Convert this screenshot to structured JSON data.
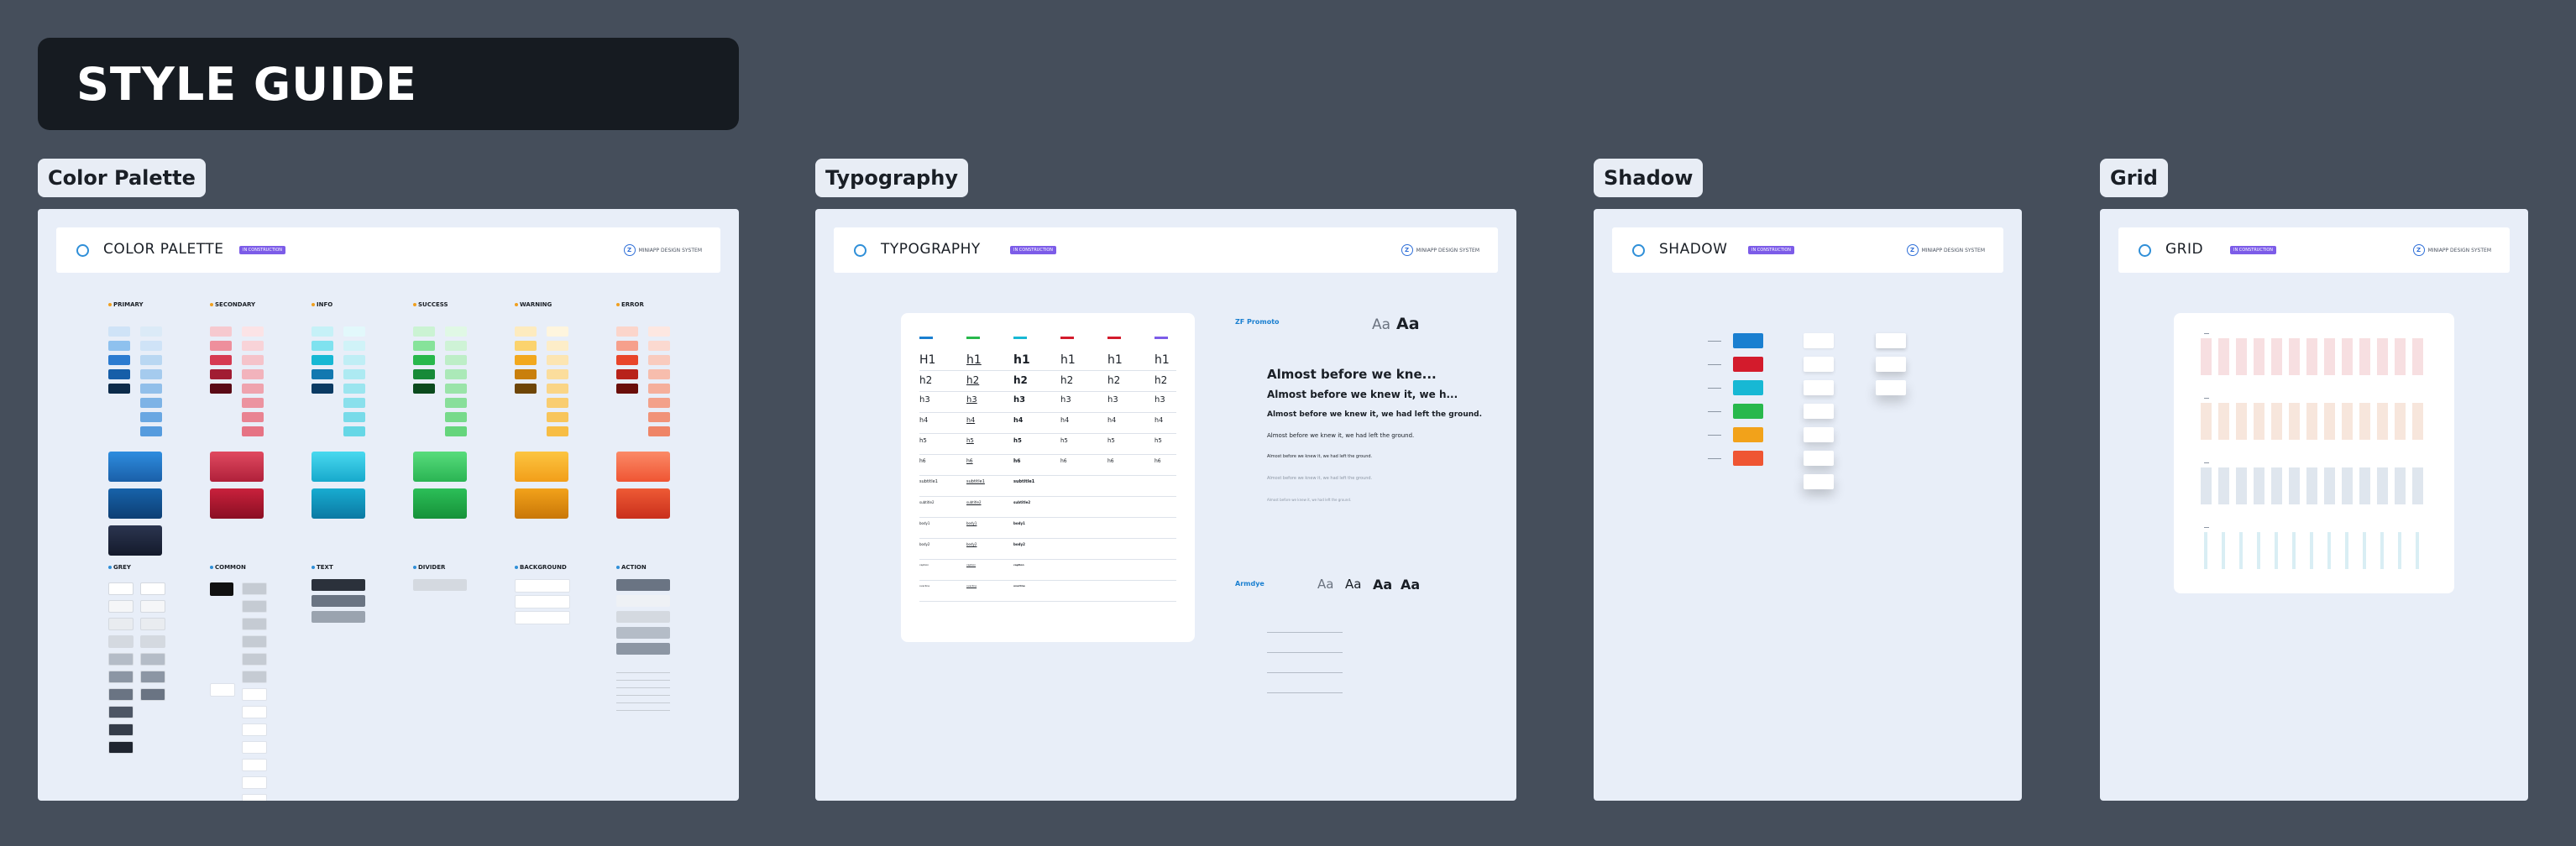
{
  "title": "STYLE GUIDE",
  "frames": {
    "color": {
      "label": "Color Palette",
      "title": "COLOR PALETTE",
      "badge": "IN CONSTRUCTION",
      "logo_text": "MINIAPP DESIGN SYSTEM"
    },
    "typography": {
      "label": "Typography",
      "title": "TYPOGRAPHY",
      "badge": "IN CONSTRUCTION",
      "logo_text": "MINIAPP DESIGN SYSTEM"
    },
    "shadow": {
      "label": "Shadow",
      "title": "SHADOW",
      "badge": "IN CONSTRUCTION",
      "logo_text": "MINIAPP DESIGN SYSTEM"
    },
    "grid": {
      "label": "Grid",
      "title": "GRID",
      "badge": "IN CONSTRUCTION",
      "logo_text": "MINIAPP DESIGN SYSTEM"
    }
  },
  "palette": {
    "groups": [
      {
        "name": "PRIMARY",
        "colors": [
          "#cfe3f7",
          "#8ec1ee",
          "#2b7bd0",
          "#165ea8",
          "#0b2a4a"
        ],
        "light": [
          "#dbeaf7",
          "#cfe3f7",
          "#b9d7f2",
          "#a5cbee",
          "#91bfea",
          "#7db3e6",
          "#69a7e2",
          "#559bde"
        ]
      },
      {
        "name": "SECONDARY",
        "colors": [
          "#f6c9cf",
          "#ee8f9c",
          "#d63a52",
          "#a11c33",
          "#5a0a16"
        ],
        "light": [
          "#fbe3e6",
          "#f8d3d8",
          "#f5c3ca",
          "#f2b3bc",
          "#efa3ae",
          "#ec93a0",
          "#e98392",
          "#e67384"
        ]
      },
      {
        "name": "INFO",
        "colors": [
          "#c6f1f7",
          "#7fe2ef",
          "#17b8d4",
          "#1278b0",
          "#0a3a63"
        ],
        "light": [
          "#e2f8fb",
          "#d0f3f8",
          "#bfeef5",
          "#adeaf2",
          "#9be5ef",
          "#8ae0ec",
          "#78dbe9",
          "#66d7e6"
        ]
      },
      {
        "name": "SUCCESS",
        "colors": [
          "#cbf3d3",
          "#86e39a",
          "#28b84c",
          "#178a38",
          "#0a4a1d"
        ],
        "light": [
          "#e0f8e5",
          "#cef3d6",
          "#bdeec7",
          "#abe9b8",
          "#9ae4a9",
          "#88df9a",
          "#77da8b",
          "#65d57c"
        ]
      },
      {
        "name": "WARNING",
        "colors": [
          "#fdebbf",
          "#fbd36e",
          "#f2a81d",
          "#c97f0c",
          "#6e4506"
        ],
        "light": [
          "#fef5de",
          "#fdedc8",
          "#fce5b2",
          "#fbdd9c",
          "#fad586",
          "#f9cd70",
          "#f8c55a",
          "#f7bd44"
        ]
      },
      {
        "name": "ERROR",
        "colors": [
          "#fbd5cb",
          "#f6a08c",
          "#e8452a",
          "#b8231a",
          "#6a0e0a"
        ],
        "light": [
          "#fde7e1",
          "#fbd9d0",
          "#f9cbbe",
          "#f7bdad",
          "#f5af9b",
          "#f3a18a",
          "#f19378",
          "#ef8567"
        ]
      }
    ],
    "gradients": [
      [
        [
          "#2e8ddf",
          "#1a5fa8"
        ],
        [
          "#1763aa",
          "#0d3f74"
        ],
        [
          "#2b3550",
          "#141a2b"
        ]
      ],
      [
        [
          "#e04a60",
          "#b0203a"
        ],
        [
          "#c9213c",
          "#8a0f23"
        ]
      ],
      [
        [
          "#49d9ef",
          "#17a9cc"
        ],
        [
          "#18acd0",
          "#0b79a3"
        ]
      ],
      [
        [
          "#58dc7c",
          "#2ab453"
        ],
        [
          "#2cbf58",
          "#169139"
        ]
      ],
      [
        [
          "#fcc541",
          "#f29e19"
        ],
        [
          "#f2a21a",
          "#c97708"
        ]
      ],
      [
        [
          "#fb8a67",
          "#ef5533"
        ],
        [
          "#ee5a35",
          "#c9301c"
        ]
      ]
    ],
    "bottom_groups": [
      "GREY",
      "COMMON",
      "TEXT",
      "DIVIDER",
      "BACKGROUND",
      "ACTION"
    ]
  },
  "typography": {
    "heading_labels": [
      "H1",
      "h1",
      "h1",
      "h1",
      "h1",
      "h1"
    ],
    "row_labels": [
      "H1",
      "h2",
      "h3",
      "h4",
      "h5",
      "h6",
      "subtitle1",
      "subtitle2",
      "body1",
      "body2",
      "caption",
      "overline"
    ],
    "font1": {
      "name": "ZF Promoto"
    },
    "font2": {
      "name": "Armdye"
    },
    "aa_labels": [
      "Aa",
      "Aa"
    ],
    "aa2_labels": [
      "Aa",
      "Aa",
      "Aa",
      "Aa"
    ],
    "samples": [
      "Almost before we kne...",
      "Almost before we knew it, we h...",
      "Almost before we knew it, we had left the ground.",
      "Almost before we knew it, we had left the ground.",
      "Almost before we knew it, we had left the ground.",
      "Almost before we knew it, we had left the ground.",
      "Almost before we knew it, we had left the ground."
    ]
  },
  "shadow": {
    "colors": [
      "#1a7fd0",
      "#d31b2c",
      "#17b8d4",
      "#28b84c",
      "#f2a21a",
      "#ef5533"
    ]
  },
  "grid": {
    "rows": [
      {
        "color": "#f7dfe1",
        "count": 13
      },
      {
        "color": "#f7e6dc",
        "count": 13
      },
      {
        "color": "#dfe6ee",
        "count": 13
      },
      {
        "color": "#d9eef4",
        "count": 13
      }
    ]
  }
}
